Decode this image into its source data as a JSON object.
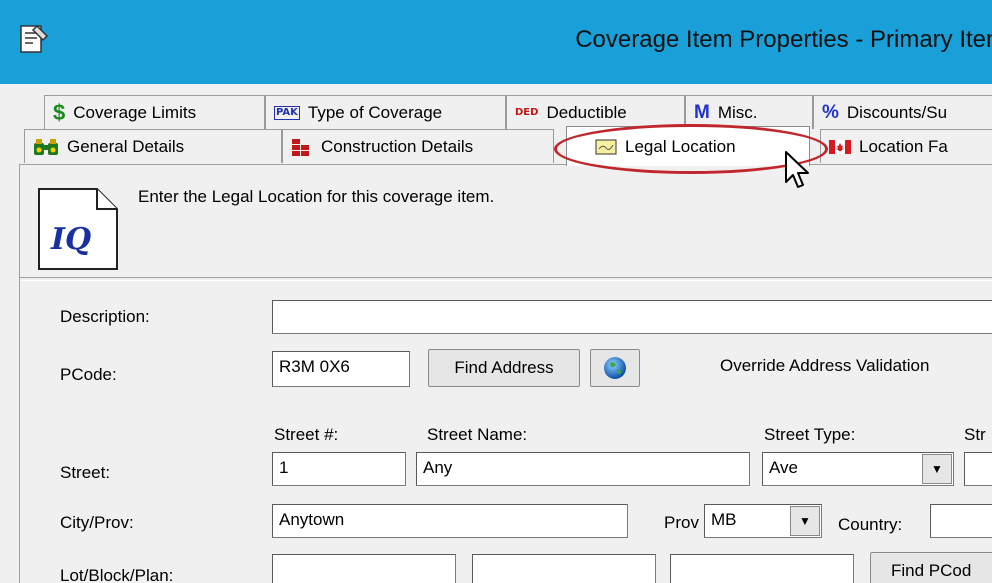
{
  "window": {
    "title": "Coverage Item Properties - Primary Item"
  },
  "tabs_row1": [
    {
      "label": "Coverage Limits",
      "icon": "dollar-icon",
      "glyph": "$"
    },
    {
      "label": "Type of Coverage",
      "icon": "pak-icon",
      "glyph": "PAK"
    },
    {
      "label": "Deductible",
      "icon": "ded-icon",
      "glyph": "DED"
    },
    {
      "label": "Misc.",
      "icon": "misc-icon",
      "glyph": "M"
    },
    {
      "label": "Discounts/Su",
      "icon": "percent-icon",
      "glyph": "%"
    }
  ],
  "tabs_row2": [
    {
      "label": "General Details",
      "icon": "binoculars-icon"
    },
    {
      "label": "Construction Details",
      "icon": "bricks-icon"
    },
    {
      "label": "Legal Location",
      "icon": "map-icon",
      "active": true
    },
    {
      "label": "Location Fa",
      "icon": "canada-flag-icon"
    }
  ],
  "panel": {
    "hint": "Enter the Legal Location for this coverage item.",
    "info_icon_text": "IQ"
  },
  "form": {
    "description_label": "Description:",
    "description_value": "",
    "pcode_label": "PCode:",
    "pcode_value": "R3M 0X6",
    "find_address_label": "Find Address",
    "override_label": "Override Address Validation",
    "street_label": "Street:",
    "street_num_header": "Street #:",
    "street_name_header": "Street  Name:",
    "street_type_header": "Street Type:",
    "street_dir_header": "Str",
    "street_num_value": "1",
    "street_name_value": "Any",
    "street_type_value": "Ave",
    "city_label": "City/Prov:",
    "city_value": "Anytown",
    "prov_label": "Prov",
    "prov_value": "MB",
    "country_label": "Country:",
    "country_value": "",
    "lot_label": "Lot/Block/Plan:",
    "find_pcode_label": "Find PCod"
  },
  "colors": {
    "titlebar": "#1aa0d8",
    "highlight_oval": "#c0272d"
  }
}
